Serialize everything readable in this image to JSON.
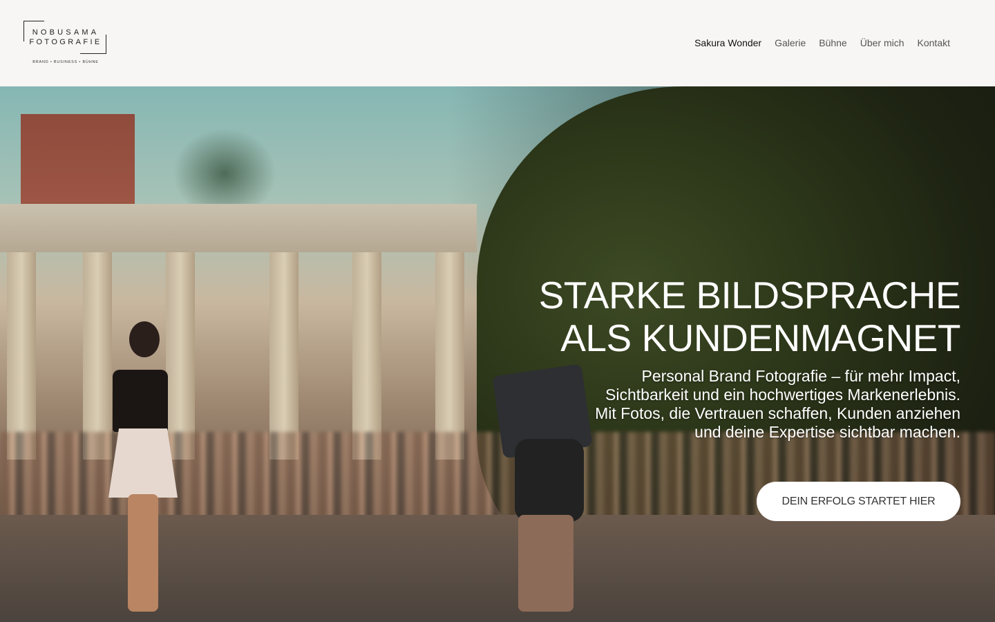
{
  "brand": {
    "line1": "NOBUSAMA",
    "line2": "FOTOGRAFIE",
    "tagline": "BRAND  •  BUSINESS  •  BÜHNE"
  },
  "nav": {
    "items": [
      {
        "label": "Sakura Wonder"
      },
      {
        "label": "Galerie"
      },
      {
        "label": "Bühne"
      },
      {
        "label": "Über mich"
      },
      {
        "label": "Kontakt"
      }
    ]
  },
  "hero": {
    "title_line1": "STARKE BILDSPRACHE",
    "title_line2": "ALS KUNDENMAGNET",
    "sub_line1": "Personal Brand Fotografie – für mehr Impact,",
    "sub_line2": "Sichtbarkeit und ein hochwertiges Markenerlebnis.",
    "sub_line3": "Mit Fotos, die Vertrauen schaffen, Kunden anziehen",
    "sub_line4": "und deine Expertise sichtbar machen.",
    "cta_label": "DEIN ERFOLG STARTET HIER"
  },
  "colors": {
    "header_bg": "#f7f6f4",
    "nav_active": "#111111",
    "nav_text": "#555555",
    "cta_bg": "#ffffff"
  }
}
